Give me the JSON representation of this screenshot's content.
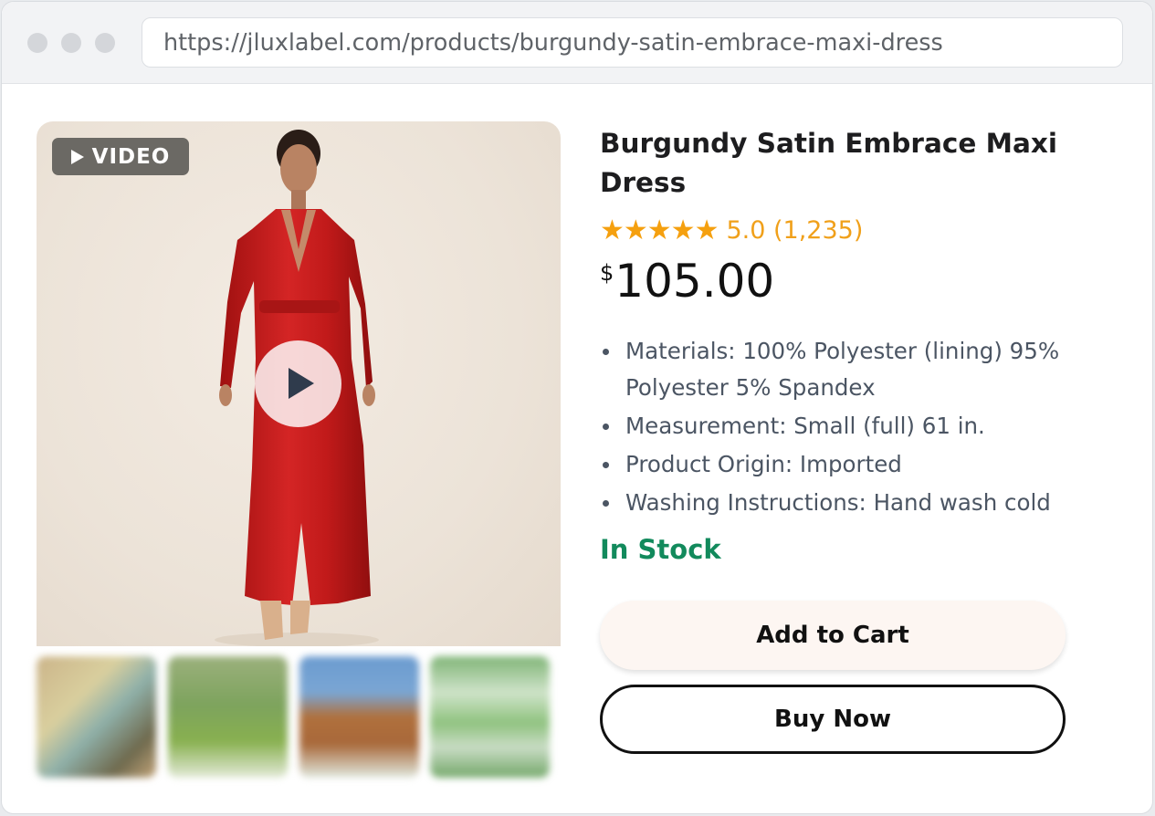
{
  "browser": {
    "url": "https://jluxlabel.com/products/burgundy-satin-embrace-maxi-dress"
  },
  "media": {
    "video_badge_label": "VIDEO",
    "thumbnails": [
      {
        "name": "thumbnail-1"
      },
      {
        "name": "thumbnail-2"
      },
      {
        "name": "thumbnail-3"
      },
      {
        "name": "thumbnail-4"
      }
    ]
  },
  "product": {
    "title": "Burgundy Satin Embrace Maxi Dress",
    "stars": "★★★★★",
    "rating_text": "5.0 (1,235)",
    "price_currency": "$",
    "price_amount": "105.00",
    "details": [
      "Materials: 100% Polyester (lining) 95% Polyester 5% Spandex",
      "Measurement: Small (full) 61 in.",
      "Product Origin: Imported",
      "Washing Instructions: Hand wash cold"
    ],
    "stock_status": "In Stock"
  },
  "actions": {
    "add_to_cart_label": "Add to Cart",
    "buy_now_label": "Buy Now"
  },
  "colors": {
    "star": "#f5a00f",
    "in_stock": "#128a5c",
    "dress": "#c11a1a"
  },
  "icons": {
    "video_badge": "play-triangle-icon",
    "video_play": "play-button-icon"
  }
}
